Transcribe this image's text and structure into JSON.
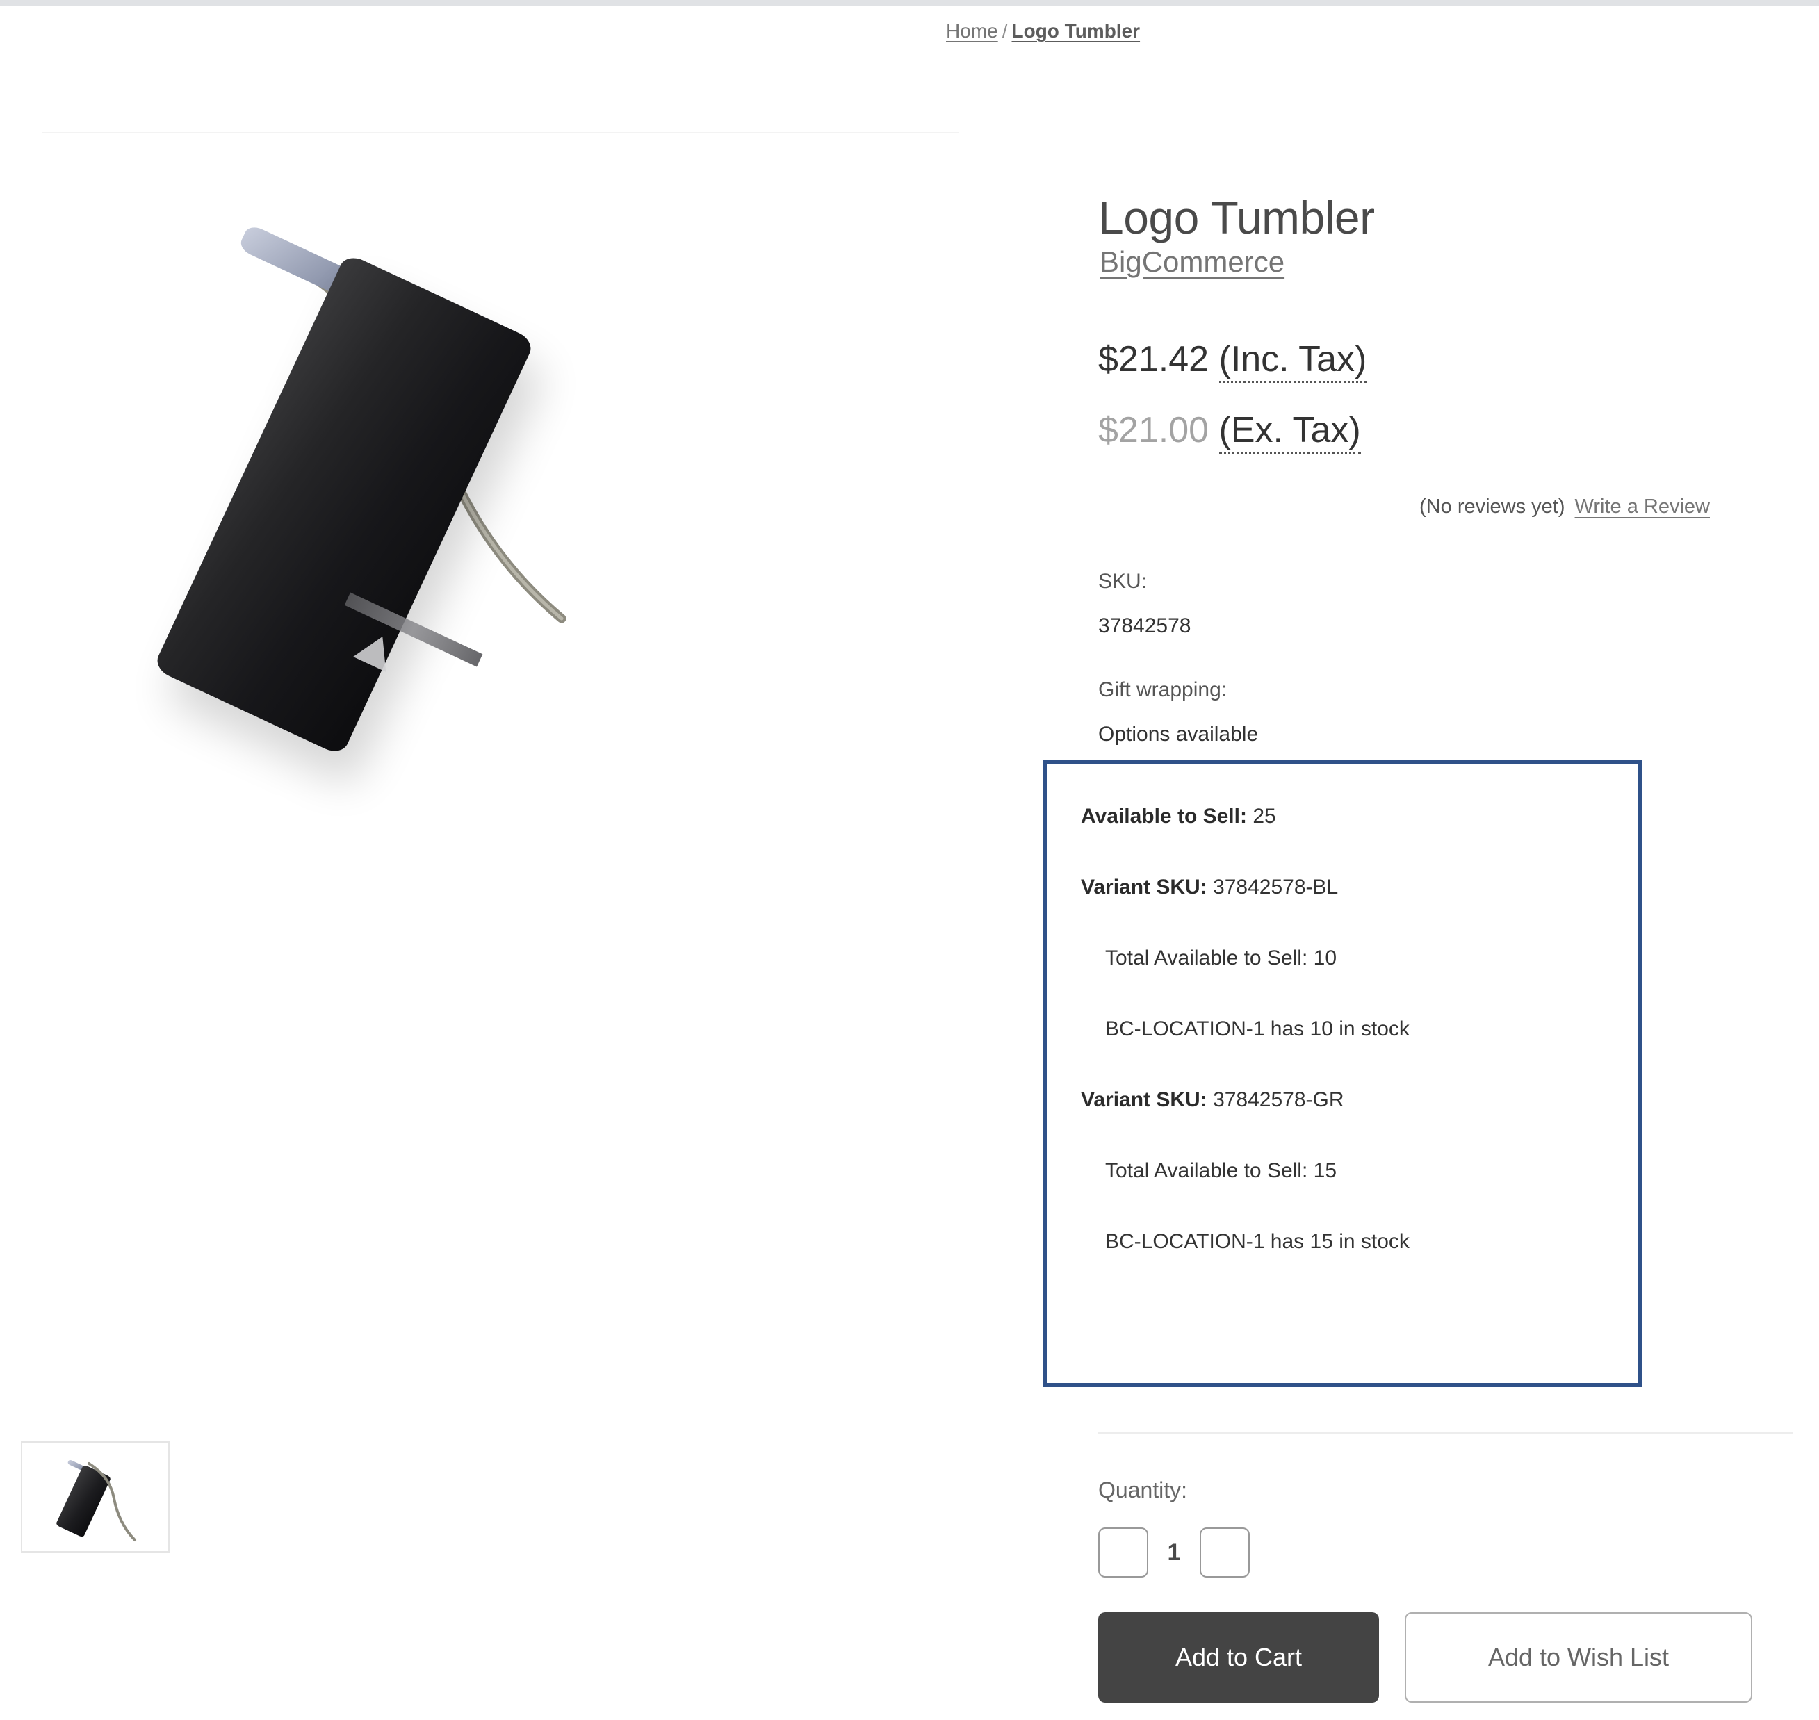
{
  "breadcrumb": {
    "home": "Home",
    "separator": "/",
    "current": "Logo Tumbler"
  },
  "product": {
    "title": "Logo Tumbler",
    "brand": "BigCommerce",
    "price_inc_tax": "$21.42",
    "price_inc_tax_note": "(Inc. Tax)",
    "price_ex_tax": "$21.00",
    "price_ex_tax_note": "(Ex. Tax)",
    "reviews_text": "(No reviews yet)",
    "write_review_label": "Write a Review",
    "sku_label": "SKU:",
    "sku_value": "37842578",
    "gift_wrapping_label": "Gift wrapping:",
    "gift_wrapping_value": "Options available"
  },
  "inventory": {
    "border_color": "#2f5189",
    "available_to_sell_label": "Available to Sell:",
    "available_to_sell_value": "25",
    "variants": [
      {
        "sku_label": "Variant SKU:",
        "sku_value": "37842578-BL",
        "total_label": "Total Available to Sell: 10",
        "location_label": "BC-LOCATION-1 has 10 in stock"
      },
      {
        "sku_label": "Variant SKU:",
        "sku_value": "37842578-GR",
        "total_label": "Total Available to Sell: 15",
        "location_label": "BC-LOCATION-1 has 15 in stock"
      }
    ]
  },
  "purchase": {
    "quantity_label": "Quantity:",
    "quantity_value": "1",
    "decrement_icon": "minus-icon",
    "increment_icon": "plus-icon",
    "add_to_cart_label": "Add to Cart",
    "add_to_wish_list_label": "Add to Wish List"
  },
  "gallery": {
    "main_image_alt": "Logo Tumbler black tumbler with metal straw",
    "thumbnail_alt": "Logo Tumbler thumbnail"
  }
}
